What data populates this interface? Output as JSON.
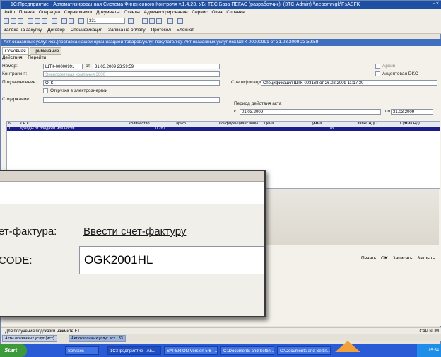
{
  "window": {
    "title": "1С:Предприятие - Автоматизированная Система Финансового Контроля  v.1.4.23, УБ: ТЕС База ПЕГАС (разработчик); (ЗТС-Admin) \\\\nepomnigk\\F:\\ASFK",
    "controls": "_ ▫ ×"
  },
  "menu": [
    "Файл",
    "Правка",
    "Операции",
    "Справочники",
    "Документы",
    "Отчеты",
    "Администрирование",
    "Сервис",
    "Окна",
    "Справка"
  ],
  "toolbar": {
    "search_value": "331"
  },
  "links": [
    "Заявка на закупку",
    "Договор",
    "Спецификация",
    "Заявка на оплату",
    "Протокол",
    "Блокнот"
  ],
  "document": {
    "title": "Акт оказанных услуг исх.(поставка нашей организацией товаров/услуг покупателю): Акт оказанных услуг исх ШТК-00000991 от 31.03.2009 23:59:59",
    "tabs": [
      "Основная",
      "Примечание"
    ],
    "actions": [
      "Действия",
      "Перейти"
    ],
    "number_label": "Номер:",
    "number_value": "ШТК-00000991",
    "date_label": "от",
    "date_value": "31.03.2009 23:59:59",
    "archive_label": "Архив",
    "counterparty_label": "Контрагент:",
    "counterparty_value": "Энергосетевая компания 3000",
    "accepted_label": "Акцептован DKO",
    "division_label": "Подразделение:",
    "division_value": "ОГК",
    "spec_label": "Спецификация:",
    "spec_value": "Спецификация ШТК-003168 от 26.02.2009 11:17:30",
    "shipment_label": "Отгрузка в электроэнергии",
    "content_label": "Содержание:",
    "period_label": "Период действия акта",
    "period_from_label": "с",
    "period_from": "01.03.2009",
    "period_to_label": "по",
    "period_to": "31.03.2009"
  },
  "table": {
    "columns": [
      "N",
      "К.Е.К.",
      "Количество",
      "Тариф",
      "Конфиденциант зоны",
      "Цена",
      "Сумма",
      "Ставка НДС",
      "Сумма НДС"
    ],
    "row": {
      "n": "1",
      "kek": "Доходы от продажи мощности",
      "qty": "0,287",
      "vat_rate": "18"
    }
  },
  "bottom_buttons": [
    "Печать",
    "OK",
    "Записать",
    "Закрыть"
  ],
  "zoom": {
    "invoice_label": "ет-фактура:",
    "invoice_link": "Ввести счет-фактуру",
    "code_label": "CODE:",
    "code_value": "OGK2001HL"
  },
  "status": {
    "hint": "Для получения подсказки нажмите F1",
    "caps": "CAP  NUM"
  },
  "window_tabs": [
    "Акты оказанных услуг (исх)",
    "Акт оказанных услуг исх...33"
  ],
  "taskbar": {
    "start": "Start",
    "tasks": [
      "Services",
      "1С:Предприятие - Ав...",
      "SAPERION Version 5.6 - ...",
      "C:\\Documents and Settin...",
      "C:\\Documents and Settin..."
    ],
    "clock": "15:54"
  },
  "colors": {
    "title_blue": "#1d4fa2",
    "selected_row": "#1b1b8a",
    "accent_orange": "#f2a13a"
  }
}
